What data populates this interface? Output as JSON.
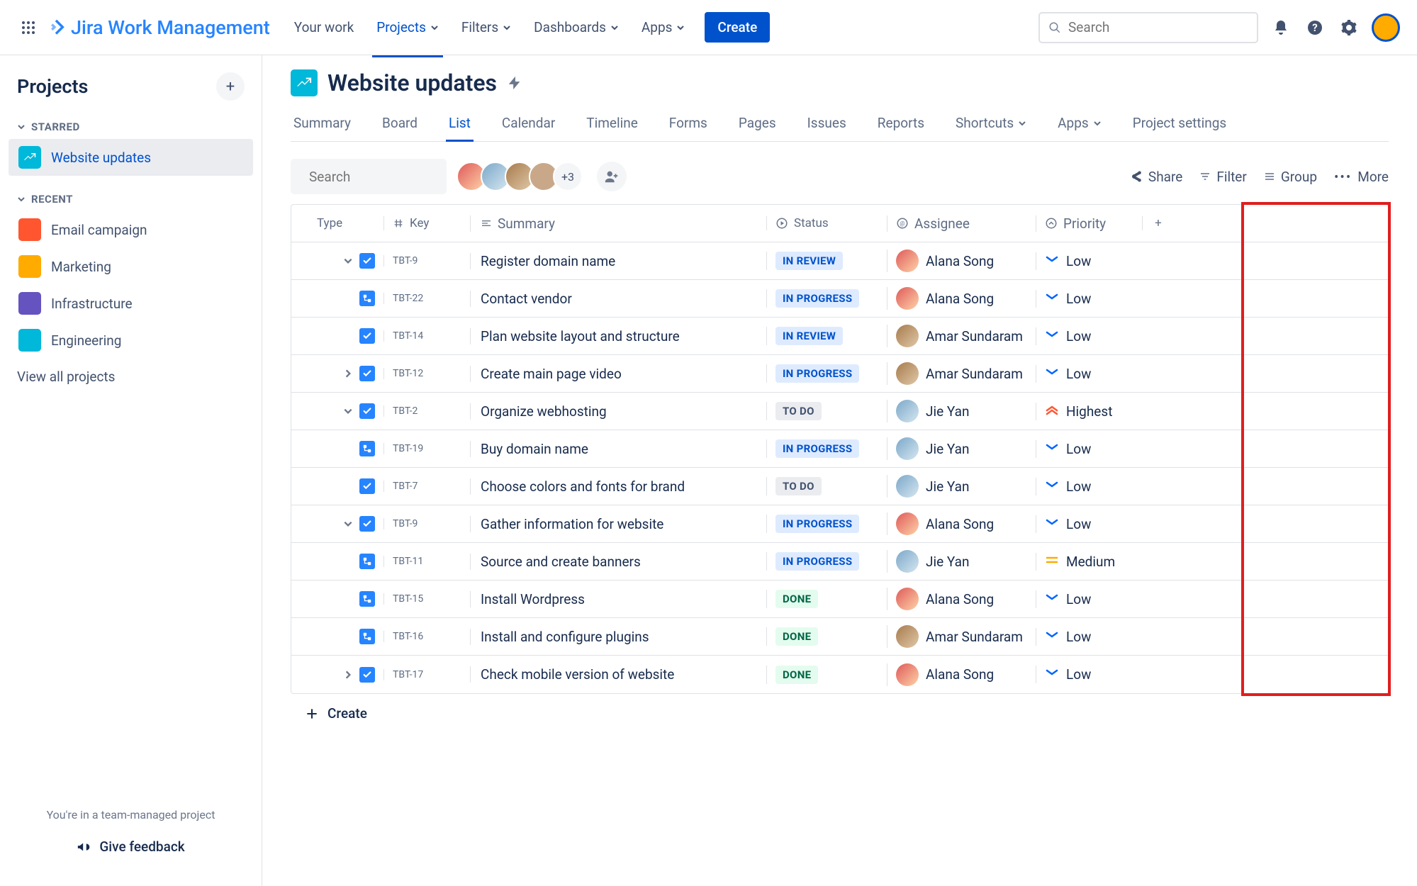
{
  "topnav": {
    "product": "Jira Work Management",
    "items": [
      "Your work",
      "Projects",
      "Filters",
      "Dashboards",
      "Apps"
    ],
    "create": "Create",
    "search_placeholder": "Search"
  },
  "sidebar": {
    "title": "Projects",
    "starred_label": "STARRED",
    "recent_label": "RECENT",
    "starred": [
      {
        "name": "Website updates",
        "color": "#00B8D9"
      }
    ],
    "recent": [
      {
        "name": "Email campaign",
        "color": "#FF5630"
      },
      {
        "name": "Marketing",
        "color": "#FFAB00"
      },
      {
        "name": "Infrastructure",
        "color": "#6554C0"
      },
      {
        "name": "Engineering",
        "color": "#00B8D9"
      }
    ],
    "view_all": "View all projects",
    "team_managed": "You're in a team-managed project",
    "give_feedback": "Give feedback"
  },
  "project": {
    "name": "Website updates",
    "tabs": [
      "Summary",
      "Board",
      "List",
      "Calendar",
      "Timeline",
      "Forms",
      "Pages",
      "Issues",
      "Reports",
      "Shortcuts",
      "Apps",
      "Project settings"
    ],
    "active_tab": "List"
  },
  "toolbar": {
    "search_placeholder": "Search",
    "avatar_extra": "+3",
    "share": "Share",
    "filter": "Filter",
    "group": "Group",
    "more": "More"
  },
  "columns": {
    "type": "Type",
    "key": "Key",
    "summary": "Summary",
    "status": "Status",
    "assignee": "Assignee",
    "priority": "Priority"
  },
  "issues": [
    {
      "expand": "down",
      "type": "task",
      "key": "TBT-9",
      "summary": "Register domain name",
      "status": "IN REVIEW",
      "status_class": "inreview",
      "assignee": "Alana Song",
      "assignee_class": "av-alana",
      "priority": "Low",
      "priority_type": "low"
    },
    {
      "indent": true,
      "type": "subtask",
      "key": "TBT-22",
      "summary": "Contact vendor",
      "status": "IN PROGRESS",
      "status_class": "inprogress",
      "assignee": "Alana Song",
      "assignee_class": "av-alana",
      "priority": "Low",
      "priority_type": "low"
    },
    {
      "type": "task",
      "key": "TBT-14",
      "summary": "Plan website layout and structure",
      "status": "IN REVIEW",
      "status_class": "inreview",
      "assignee": "Amar Sundaram",
      "assignee_class": "av-amar",
      "priority": "Low",
      "priority_type": "low"
    },
    {
      "expand": "right",
      "type": "task",
      "key": "TBT-12",
      "summary": "Create main page video",
      "status": "IN PROGRESS",
      "status_class": "inprogress",
      "assignee": "Amar Sundaram",
      "assignee_class": "av-amar",
      "priority": "Low",
      "priority_type": "low"
    },
    {
      "expand": "down",
      "type": "task",
      "key": "TBT-2",
      "summary": "Organize webhosting",
      "status": "TO DO",
      "status_class": "todo",
      "assignee": "Jie Yan",
      "assignee_class": "av-jie",
      "priority": "Highest",
      "priority_type": "highest"
    },
    {
      "indent": true,
      "type": "subtask",
      "key": "TBT-19",
      "summary": "Buy domain name",
      "status": "IN PROGRESS",
      "status_class": "inprogress",
      "assignee": "Jie Yan",
      "assignee_class": "av-jie",
      "priority": "Low",
      "priority_type": "low"
    },
    {
      "type": "task",
      "key": "TBT-7",
      "summary": "Choose colors and fonts for brand",
      "status": "TO DO",
      "status_class": "todo",
      "assignee": "Jie Yan",
      "assignee_class": "av-jie",
      "priority": "Low",
      "priority_type": "low"
    },
    {
      "expand": "down",
      "type": "task",
      "key": "TBT-9",
      "summary": "Gather information for website",
      "status": "IN PROGRESS",
      "status_class": "inprogress",
      "assignee": "Alana Song",
      "assignee_class": "av-alana",
      "priority": "Low",
      "priority_type": "low"
    },
    {
      "indent": true,
      "type": "subtask",
      "key": "TBT-11",
      "summary": "Source and create banners",
      "status": "IN PROGRESS",
      "status_class": "inprogress",
      "assignee": "Jie Yan",
      "assignee_class": "av-jie",
      "priority": "Medium",
      "priority_type": "medium"
    },
    {
      "indent": true,
      "type": "subtask",
      "key": "TBT-15",
      "summary": "Install Wordpress",
      "status": "DONE",
      "status_class": "done",
      "assignee": "Alana Song",
      "assignee_class": "av-alana",
      "priority": "Low",
      "priority_type": "low"
    },
    {
      "indent": true,
      "type": "subtask",
      "key": "TBT-16",
      "summary": "Install and configure plugins",
      "status": "DONE",
      "status_class": "done",
      "assignee": "Amar Sundaram",
      "assignee_class": "av-amar",
      "priority": "Low",
      "priority_type": "low"
    },
    {
      "expand": "right",
      "type": "task",
      "key": "TBT-17",
      "summary": "Check mobile version of website",
      "status": "DONE",
      "status_class": "done",
      "assignee": "Alana Song",
      "assignee_class": "av-alana",
      "priority": "Low",
      "priority_type": "low"
    }
  ],
  "create_row": "Create"
}
